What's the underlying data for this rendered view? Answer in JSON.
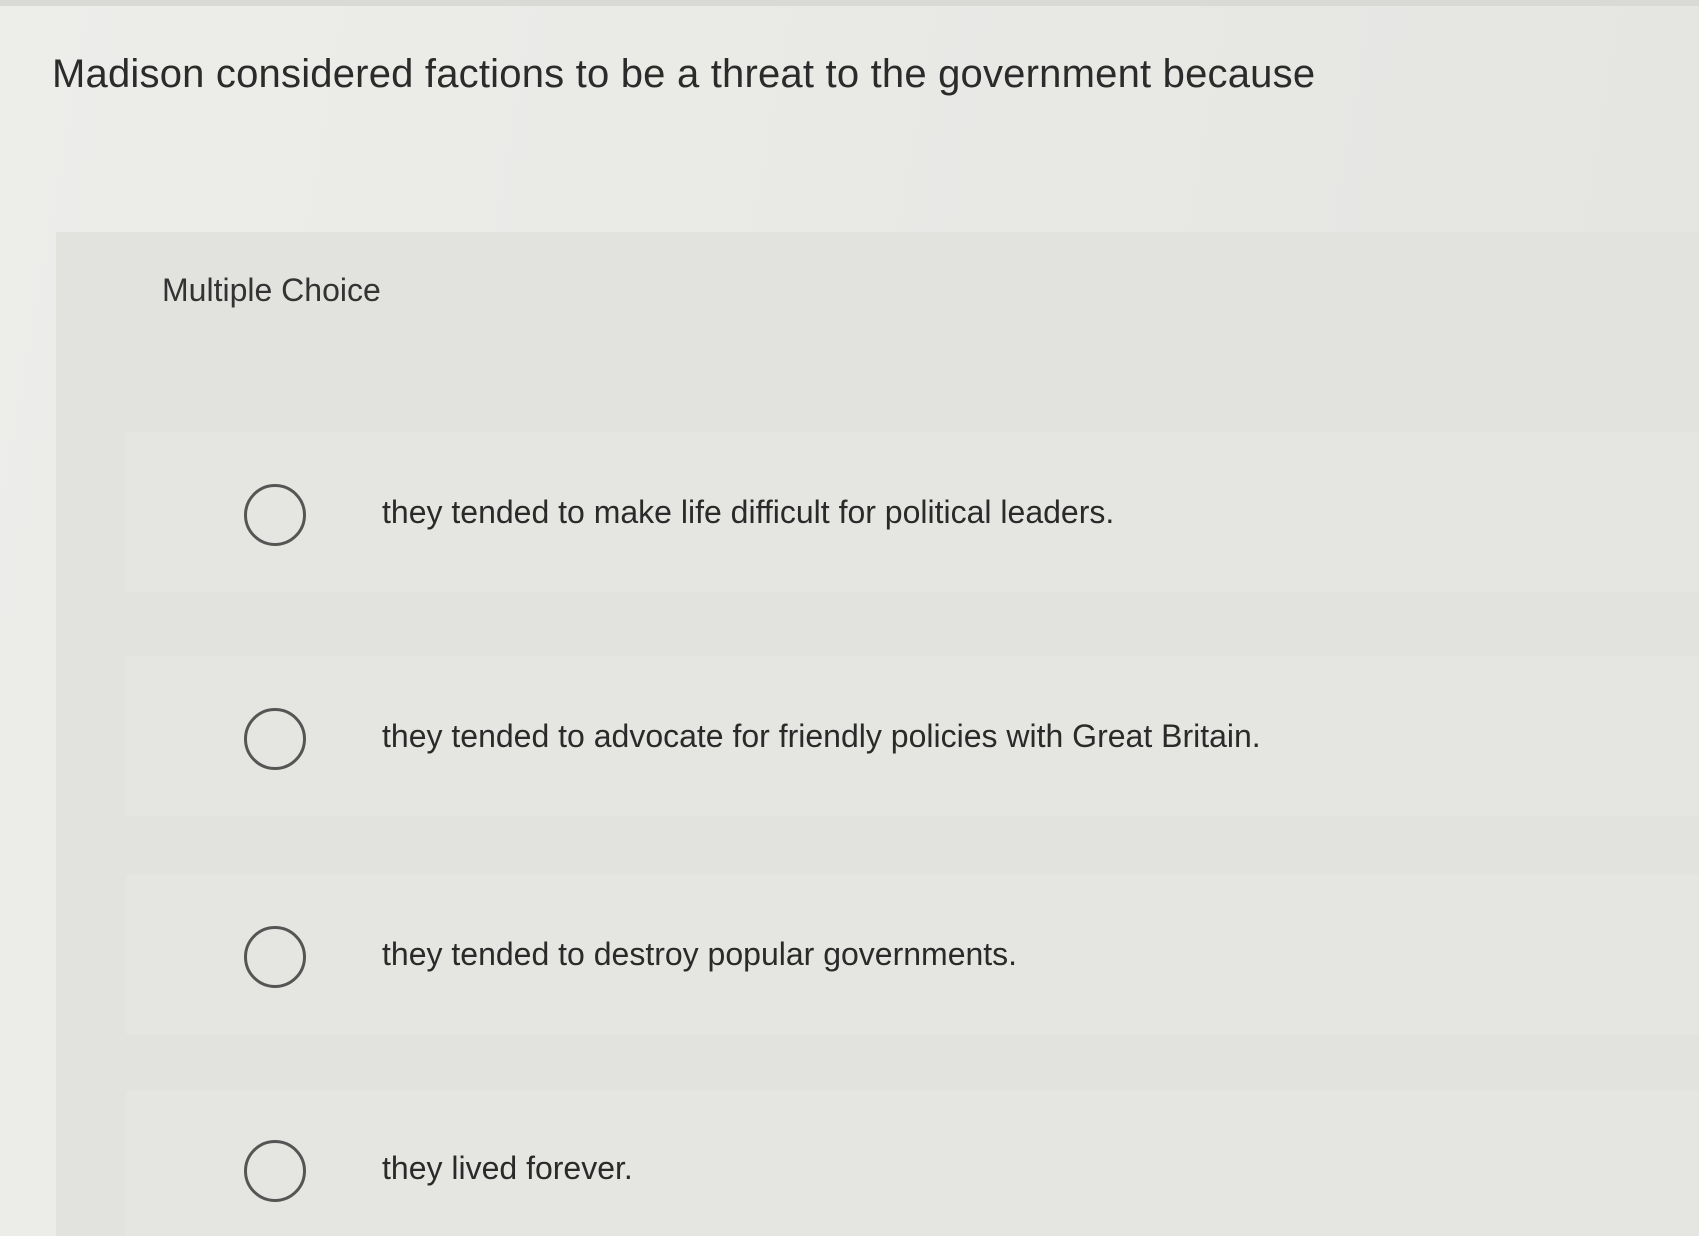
{
  "question": {
    "text": "Madison considered factions to be a threat to the government because"
  },
  "panel": {
    "label": "Multiple Choice"
  },
  "options": [
    {
      "text": "they tended to make life difficult for political leaders.",
      "selected": false
    },
    {
      "text": "they tended to advocate for friendly policies with Great Britain.",
      "selected": false
    },
    {
      "text": "they tended to destroy popular governments.",
      "selected": false
    },
    {
      "text": "they lived forever.",
      "selected": false
    }
  ],
  "colors": {
    "background": "#e9e9e6",
    "text": "#2e2e2e",
    "radio_border": "#555555"
  },
  "icons": {
    "radio": "radio-unchecked-icon"
  }
}
